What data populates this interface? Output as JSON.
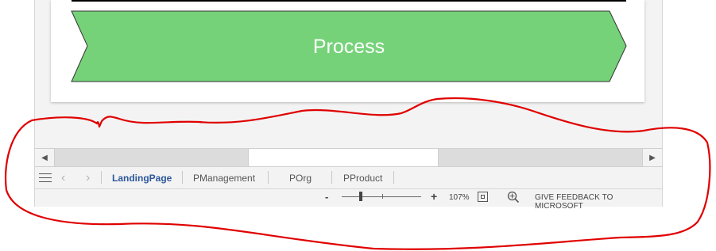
{
  "diagram": {
    "process_label": "Process",
    "process_color": "#75d279"
  },
  "sheet_tabs": {
    "active": "LandingPage",
    "items": [
      "LandingPage",
      "PManagement",
      "POrg",
      "PProduct"
    ]
  },
  "status_bar": {
    "zoom_minus": "-",
    "zoom_plus": "+",
    "zoom_level": "107%",
    "zoom_fraction": 0.24,
    "feedback": "GIVE FEEDBACK TO MICROSOFT"
  },
  "icons": {
    "scroll_left": "triangle-left",
    "scroll_right": "triangle-right",
    "menu": "hamburger",
    "prev_sheet": "chevron-left",
    "next_sheet": "chevron-right",
    "fit_page": "fit-page-icon",
    "pan_zoom": "pan-zoom-icon"
  },
  "colors": {
    "active_tab": "#2b579a",
    "annotation": "#e00000"
  }
}
